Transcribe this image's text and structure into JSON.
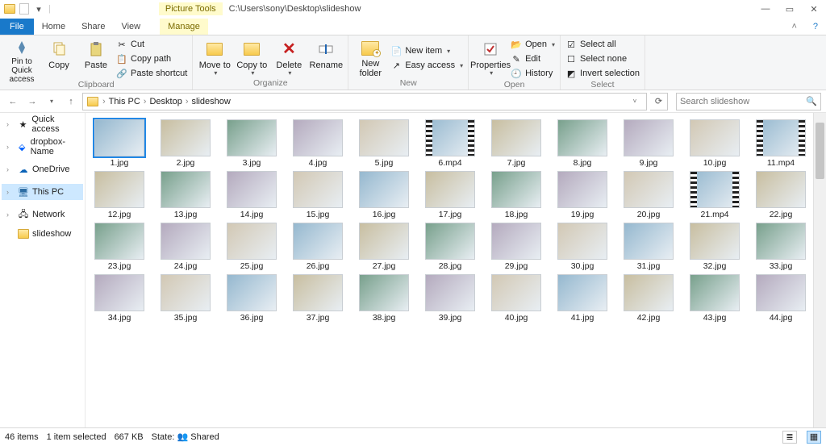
{
  "title": {
    "context_tools": "Picture Tools",
    "path": "C:\\Users\\sony\\Desktop\\slideshow"
  },
  "tabs": {
    "file": "File",
    "home": "Home",
    "share": "Share",
    "view": "View",
    "manage": "Manage"
  },
  "ribbon": {
    "clipboard": {
      "pin_to": "Pin to Quick access",
      "copy": "Copy",
      "paste": "Paste",
      "cut": "Cut",
      "copy_path": "Copy path",
      "paste_shortcut": "Paste shortcut",
      "label": "Clipboard"
    },
    "organize": {
      "move_to": "Move to",
      "copy_to": "Copy to",
      "delete": "Delete",
      "rename": "Rename",
      "label": "Organize"
    },
    "new": {
      "new_folder": "New folder",
      "new_item": "New item",
      "easy_access": "Easy access",
      "label": "New"
    },
    "open": {
      "properties": "Properties",
      "open": "Open",
      "edit": "Edit",
      "history": "History",
      "label": "Open"
    },
    "select": {
      "select_all": "Select all",
      "select_none": "Select none",
      "invert": "Invert selection",
      "label": "Select"
    }
  },
  "breadcrumb": {
    "this_pc": "This PC",
    "desktop": "Desktop",
    "folder": "slideshow"
  },
  "search": {
    "placeholder": "Search slideshow"
  },
  "nav": {
    "quick_access": "Quick access",
    "dropbox": "dropbox-Name",
    "onedrive": "OneDrive",
    "this_pc": "This PC",
    "network": "Network",
    "slideshow": "slideshow"
  },
  "files": [
    {
      "name": "1.jpg",
      "video": false,
      "sel": true
    },
    {
      "name": "2.jpg",
      "video": false
    },
    {
      "name": "3.jpg",
      "video": false
    },
    {
      "name": "4.jpg",
      "video": false
    },
    {
      "name": "5.jpg",
      "video": false
    },
    {
      "name": "6.mp4",
      "video": true
    },
    {
      "name": "7.jpg",
      "video": false
    },
    {
      "name": "8.jpg",
      "video": false
    },
    {
      "name": "9.jpg",
      "video": false
    },
    {
      "name": "10.jpg",
      "video": false
    },
    {
      "name": "11.mp4",
      "video": true
    },
    {
      "name": "12.jpg",
      "video": false
    },
    {
      "name": "13.jpg",
      "video": false
    },
    {
      "name": "14.jpg",
      "video": false
    },
    {
      "name": "15.jpg",
      "video": false
    },
    {
      "name": "16.jpg",
      "video": false
    },
    {
      "name": "17.jpg",
      "video": false
    },
    {
      "name": "18.jpg",
      "video": false
    },
    {
      "name": "19.jpg",
      "video": false
    },
    {
      "name": "20.jpg",
      "video": false
    },
    {
      "name": "21.mp4",
      "video": true
    },
    {
      "name": "22.jpg",
      "video": false
    },
    {
      "name": "23.jpg",
      "video": false
    },
    {
      "name": "24.jpg",
      "video": false
    },
    {
      "name": "25.jpg",
      "video": false
    },
    {
      "name": "26.jpg",
      "video": false
    },
    {
      "name": "27.jpg",
      "video": false
    },
    {
      "name": "28.jpg",
      "video": false
    },
    {
      "name": "29.jpg",
      "video": false
    },
    {
      "name": "30.jpg",
      "video": false
    },
    {
      "name": "31.jpg",
      "video": false
    },
    {
      "name": "32.jpg",
      "video": false
    },
    {
      "name": "33.jpg",
      "video": false
    },
    {
      "name": "34.jpg",
      "video": false
    },
    {
      "name": "35.jpg",
      "video": false
    },
    {
      "name": "36.jpg",
      "video": false
    },
    {
      "name": "37.jpg",
      "video": false
    },
    {
      "name": "38.jpg",
      "video": false
    },
    {
      "name": "39.jpg",
      "video": false
    },
    {
      "name": "40.jpg",
      "video": false
    },
    {
      "name": "41.jpg",
      "video": false
    },
    {
      "name": "42.jpg",
      "video": false
    },
    {
      "name": "43.jpg",
      "video": false
    },
    {
      "name": "44.jpg",
      "video": false
    }
  ],
  "status": {
    "items": "46 items",
    "selected": "1 item selected",
    "size": "667 KB",
    "state_label": "State:",
    "state_value": "Shared"
  }
}
